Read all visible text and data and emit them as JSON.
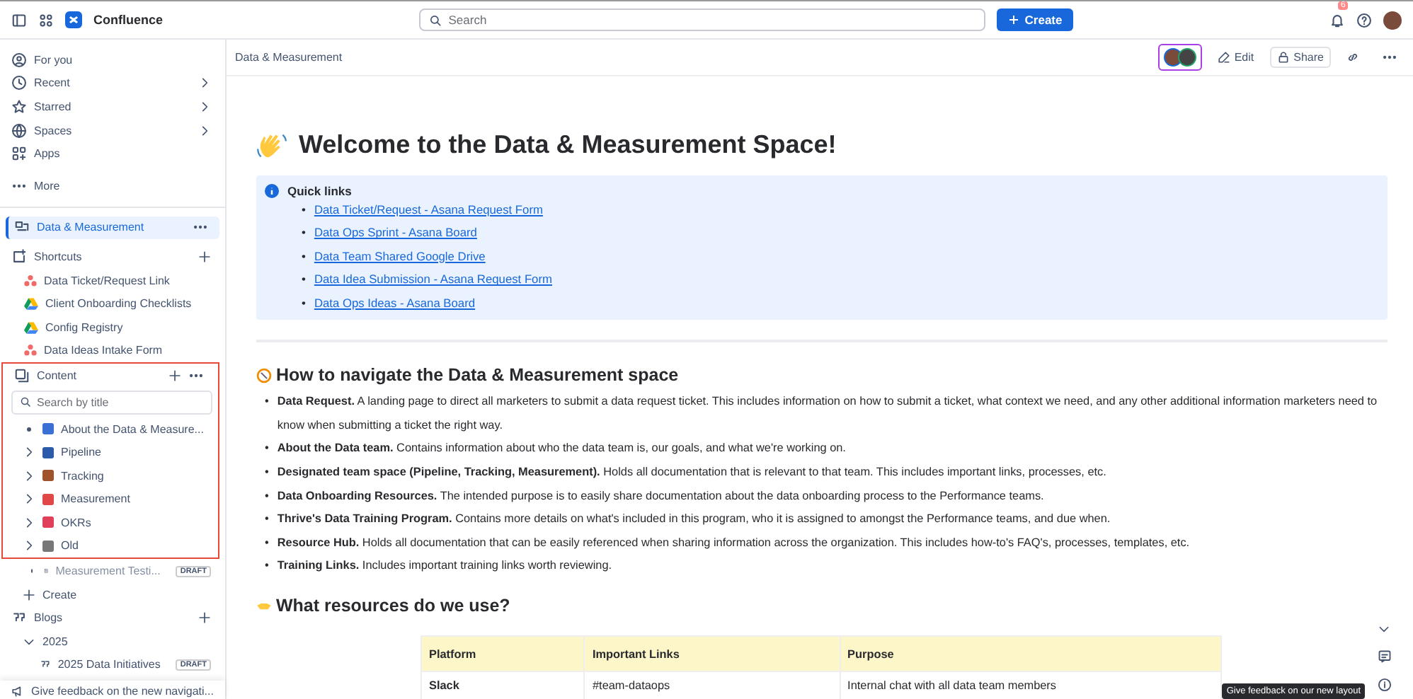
{
  "topbar": {
    "app_name": "Confluence",
    "search": {
      "placeholder": "Search"
    },
    "create_button": "Create",
    "notification_count": "6"
  },
  "sidebar": {
    "nav": [
      {
        "label": "For you",
        "has_arrow": false
      },
      {
        "label": "Recent",
        "has_arrow": true
      },
      {
        "label": "Starred",
        "has_arrow": true
      },
      {
        "label": "Spaces",
        "has_arrow": true
      },
      {
        "label": "Apps",
        "has_arrow": false
      }
    ],
    "more": "More",
    "space": {
      "label": "Data & Measurement",
      "selected": true
    },
    "shortcuts": {
      "title": "Shortcuts",
      "items": [
        {
          "label": "Data Ticket/Request Link",
          "kind": "form"
        },
        {
          "label": "Client Onboarding Checklists",
          "kind": "drive"
        },
        {
          "label": "Config Registry",
          "kind": "drive"
        },
        {
          "label": "Data Ideas Intake Form",
          "kind": "form"
        }
      ]
    },
    "content": {
      "title": "Content",
      "highlighted": true,
      "search": {
        "placeholder": "Search by title"
      },
      "tree": [
        {
          "label": "About the Data & Measure...",
          "kind": "leaf",
          "color": "#3b6fd4"
        },
        {
          "label": "Pipeline",
          "kind": "parent",
          "color": "#2a5aa8"
        },
        {
          "label": "Tracking",
          "kind": "parent",
          "color": "#a0522d"
        },
        {
          "label": "Measurement",
          "kind": "parent",
          "color": "#e04848"
        },
        {
          "label": "OKRs",
          "kind": "parent",
          "color": "#e0405a"
        },
        {
          "label": "Old",
          "kind": "parent",
          "color": "#777777"
        }
      ],
      "after": [
        {
          "label": "Measurement Testi...",
          "badge": "DRAFT",
          "dimmed": true
        }
      ],
      "create": "Create"
    },
    "blogs": {
      "title": "Blogs",
      "groups": [
        {
          "label": "2025",
          "expanded": true,
          "items": [
            {
              "label": "2025 Data Initiatives",
              "badge": "DRAFT"
            }
          ]
        }
      ]
    },
    "feedback": "Give feedback on the new navigati..."
  },
  "page": {
    "breadcrumb": "Data & Measurement",
    "actions": {
      "edit": "Edit",
      "share": "Share"
    },
    "title": "Welcome to the Data & Measurement Space!",
    "quick_links": {
      "title": "Quick links",
      "marker": "•",
      "links": [
        "Data Ticket/Request - Asana Request Form",
        "Data Ops Sprint - Asana Board",
        "Data Team Shared Google Drive",
        "Data Idea Submission - Asana Request Form",
        "Data Ops Ideas - Asana Board"
      ]
    },
    "nav_section": {
      "title": "How to navigate the Data & Measurement space",
      "marker": "•",
      "items": [
        "**Data Request.** A landing page to direct all marketers to submit a data request ticket. This includes information on how to submit a ticket, what context we need, and any other additional information marketers need to know when submitting a ticket the right way.",
        "**About the Data team.** Contains information about who the data team is, our goals, and what we're working on.",
        "**Designated team space (Pipeline, Tracking, Measurement).** Holds all documentation that is relevant to that team. This includes important links, processes, etc.",
        "**Data Onboarding Resources.** The intended purpose is to easily share documentation about the data onboarding process to the Performance teams.",
        "**Thrive's Data Training Program.** Contains more details on what's included in this program, who it is assigned to amongst the Performance teams, and due when.",
        "**Resource Hub.** Holds all documentation that can be easily referenced when sharing information across the organization. This includes how-to's FAQ's, processes, templates, etc.",
        "**Training Links.** Includes important training links worth reviewing."
      ]
    },
    "resources": {
      "title": "What resources do we use?",
      "table": {
        "columns": [
          "Platform",
          "Important Links",
          "Purpose"
        ],
        "rows": [
          [
            "Slack",
            "#team-dataops",
            "Internal chat with all data team members"
          ]
        ]
      }
    },
    "tooltip": "Give feedback on our new layout"
  }
}
